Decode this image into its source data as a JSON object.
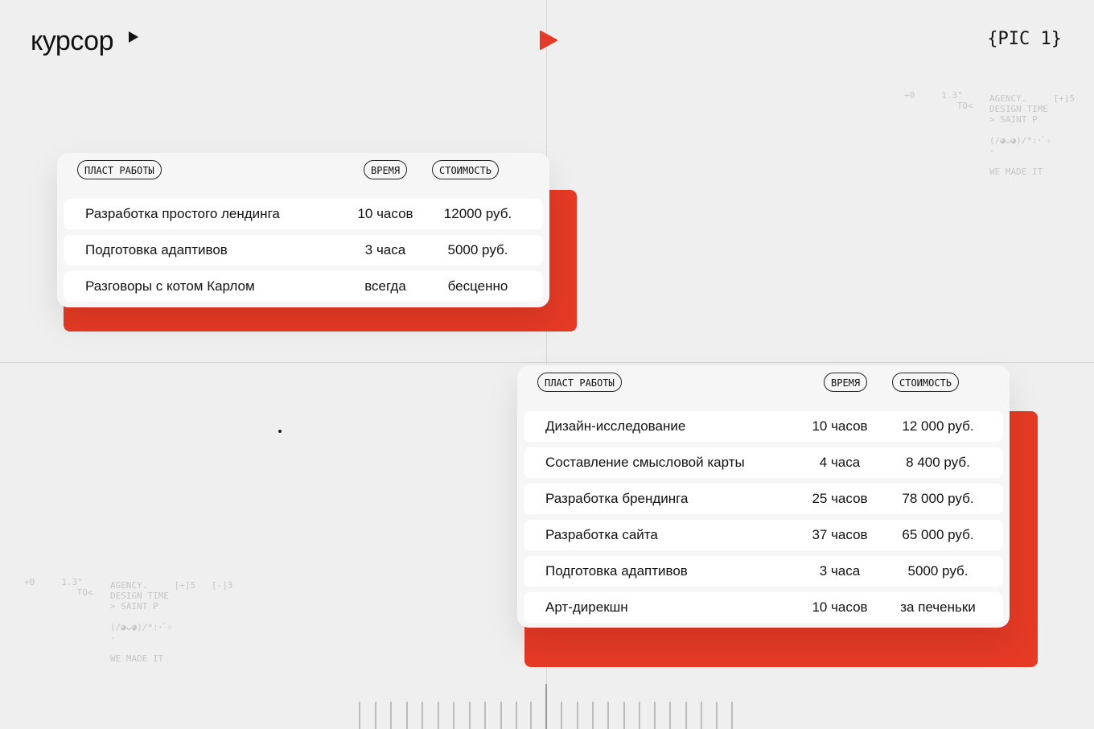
{
  "header": {
    "logo_text": "курсор",
    "pic_label": "{PIC 1}"
  },
  "deco": {
    "block_right": {
      "col1": "+0     1.3\"",
      "col2": "         TO<",
      "col3": "AGENCY.     [+]5\nDESIGN TIME\n> SAINT P\n\n(/◕ᴗ◕)/*:･ﾟ✧\n-\n\nWE MADE IT"
    },
    "block_left": {
      "col1": "+0     1.3\"",
      "col2": "         TO<",
      "col3": "AGENCY.     [+]5   [-]3\nDESIGN TIME\n> SAINT P\n\n(/◕ᴗ◕)/*:･ﾟ✧\n-\n\nWE MADE IT"
    }
  },
  "table1": {
    "headers": [
      "ПЛАСТ РАБОТЫ",
      "ВРЕМЯ",
      "СТОИМОСТЬ"
    ],
    "rows": [
      [
        "Разработка простого лендинга",
        "10 часов",
        "12000 руб."
      ],
      [
        "Подготовка адаптивов",
        "3 часа",
        "5000 руб."
      ],
      [
        "Разговоры с котом Карлом",
        "всегда",
        "бесценно"
      ]
    ]
  },
  "table2": {
    "headers": [
      "ПЛАСТ РАБОТЫ",
      "ВРЕМЯ",
      "СТОИМОСТЬ"
    ],
    "rows": [
      [
        "Дизайн-исследование",
        "10 часов",
        "12 000 руб."
      ],
      [
        "Составление смысловой карты",
        "4 часа",
        "8 400 руб."
      ],
      [
        "Разработка брендинга",
        "25 часов",
        "78 000 руб."
      ],
      [
        "Разработка сайта",
        "37 часов",
        "65 000 руб."
      ],
      [
        "Подготовка адаптивов",
        "3 часа",
        "5000 руб."
      ],
      [
        "Арт-дирекшн",
        "10 часов",
        "за печеньки"
      ]
    ]
  },
  "colors": {
    "accent": "#e53a25",
    "background": "#efefef",
    "card": "#f6f6f6"
  },
  "icons": [
    "cursor-arrow-icon",
    "play-icon"
  ]
}
